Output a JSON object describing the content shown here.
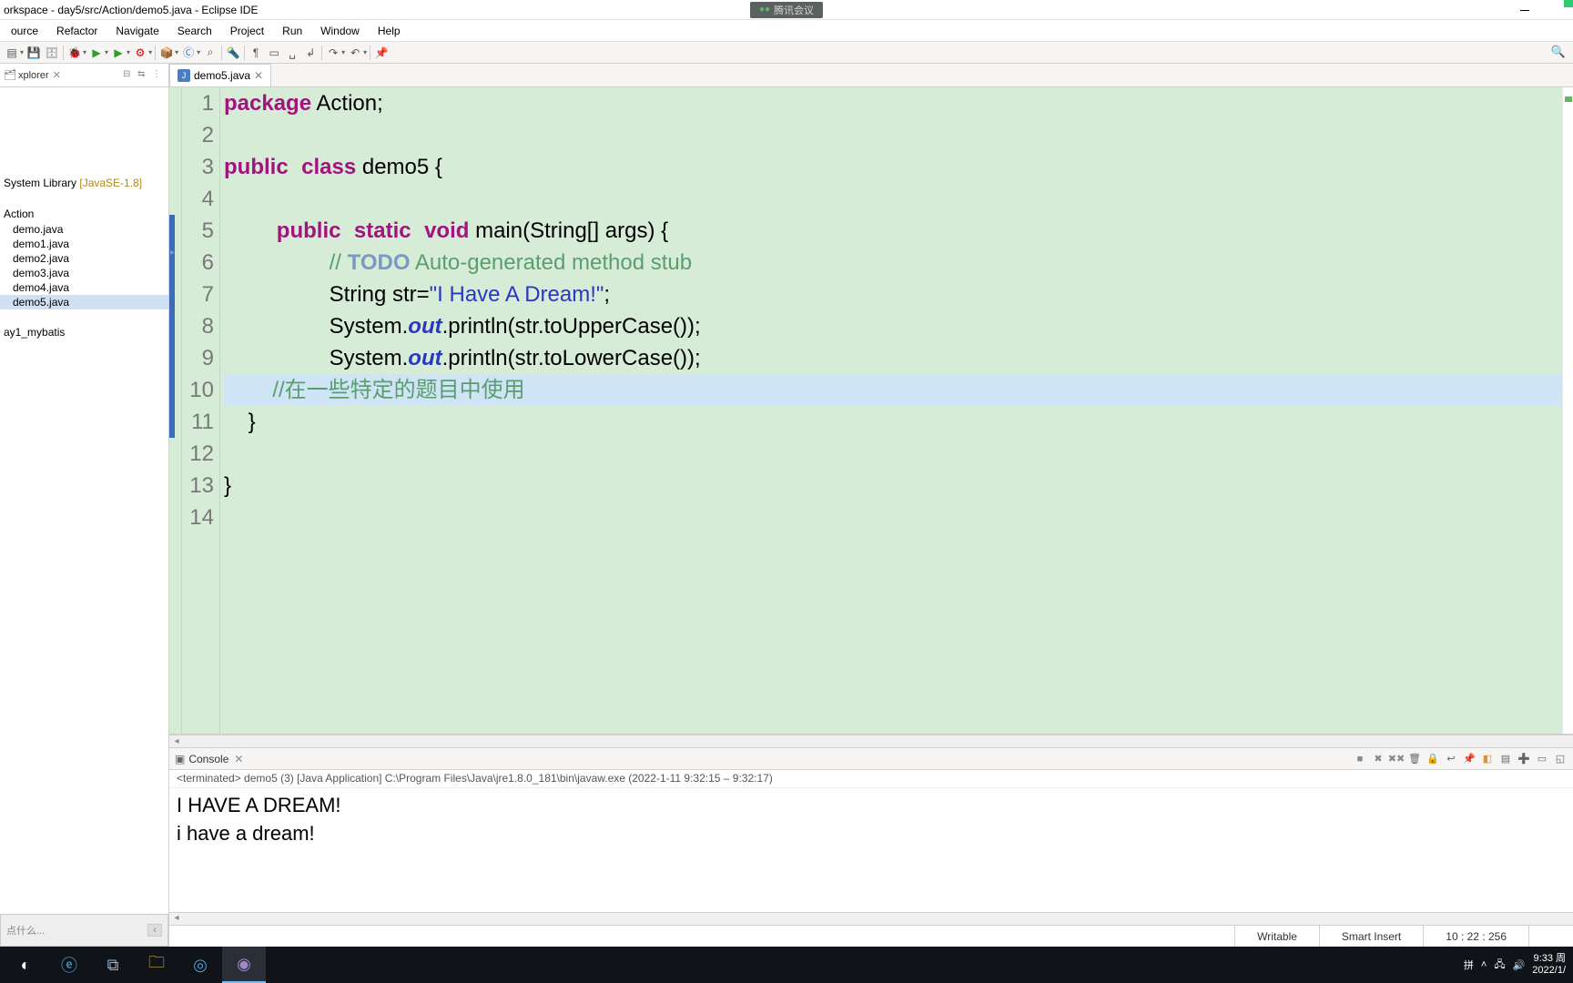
{
  "window": {
    "title": "orkspace - day5/src/Action/demo5.java - Eclipse IDE",
    "tencent": "腾讯会议"
  },
  "menu": [
    "ource",
    "Refactor",
    "Navigate",
    "Search",
    "Project",
    "Run",
    "Window",
    "Help"
  ],
  "explorer": {
    "tab_label": "xplorer",
    "library_prefix": "System Library ",
    "library_suffix": "[JavaSE-1.8]",
    "package": "Action",
    "files": [
      "demo.java",
      "demo1.java",
      "demo2.java",
      "demo3.java",
      "demo4.java",
      "demo5.java"
    ],
    "selected_index": 5,
    "other_project": "ay1_mybatis",
    "bottom_placeholder": "点什么..."
  },
  "editor": {
    "tab_label": "demo5.java",
    "gutter": [
      "1",
      "2",
      "3",
      "4",
      "5",
      "6",
      "7",
      "8",
      "9",
      "10",
      "11",
      "12",
      "13",
      "14"
    ],
    "code": {
      "l1_pkg": "package",
      "l1_rest": " Action;",
      "l3_pub": "public",
      "l3_class": "class",
      "l3_rest": " demo5 {",
      "l5_pub": "public",
      "l5_static": "static",
      "l5_void": "void",
      "l5_rest": " main(String[] args) {",
      "l6_slashes": "// ",
      "l6_todo": "TODO",
      "l6_rest": " Auto-generated method stub",
      "l7_a": "String str=",
      "l7_str": "\"I Have A Dream!\"",
      "l7_b": ";",
      "l8_a": "System.",
      "l8_out": "out",
      "l8_b": ".println(str.toUpperCase());",
      "l9_a": "System.",
      "l9_out": "out",
      "l9_b": ".println(str.toLowerCase());",
      "l10": "//在一些特定的题目中使用",
      "l11": "    }",
      "l13": "}"
    }
  },
  "console": {
    "tab_label": "Console",
    "info": "<terminated> demo5 (3) [Java Application] C:\\Program Files\\Java\\jre1.8.0_181\\bin\\javaw.exe  (2022-1-11 9:32:15 – 9:32:17)",
    "out1": "I HAVE A DREAM!",
    "out2": "i have a dream!"
  },
  "status": {
    "writable": "Writable",
    "insert": "Smart Insert",
    "pos": "10 : 22 : 256"
  },
  "tray": {
    "ime": "拼",
    "time": "9:33 周",
    "date": "2022/1/"
  }
}
